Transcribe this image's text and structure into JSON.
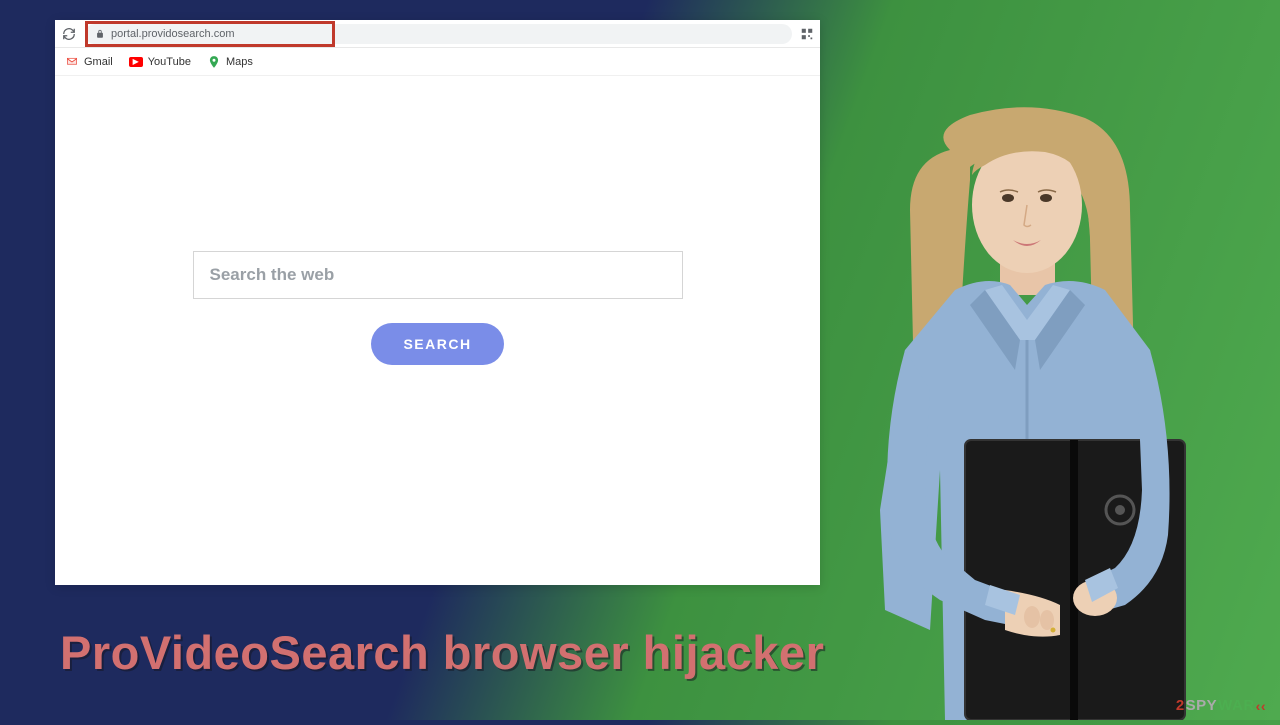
{
  "browser": {
    "url": "portal.providosearch.com",
    "bookmarks": [
      {
        "label": "Gmail",
        "icon": "gmail"
      },
      {
        "label": "YouTube",
        "icon": "youtube"
      },
      {
        "label": "Maps",
        "icon": "maps"
      }
    ]
  },
  "search": {
    "placeholder": "Search the web",
    "button_label": "SEARCH"
  },
  "headline": "ProVideoSearch browser hijacker",
  "watermark": {
    "part1": "2",
    "part2": "SPY",
    "part3": "WAR",
    "part4": "‹‹"
  }
}
